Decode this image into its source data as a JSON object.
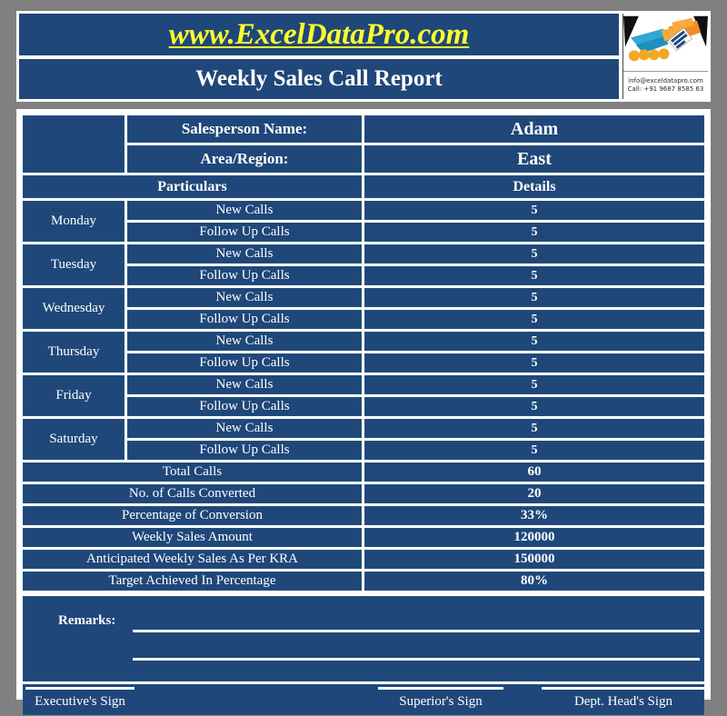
{
  "header": {
    "url": "www.ExcelDataPro.com",
    "title": "Weekly Sales Call Report",
    "logo": {
      "icon": "handshake-logo",
      "email": "info@exceldatapro.com",
      "phone": "Call: +91 9687 8585 63"
    }
  },
  "info": {
    "salesperson_label": "Salesperson Name:",
    "salesperson_value": "Adam",
    "region_label": "Area/Region:",
    "region_value": "East"
  },
  "columns": {
    "particulars": "Particulars",
    "details": "Details"
  },
  "days": [
    {
      "day": "Monday",
      "rows": [
        {
          "particular": "New Calls",
          "value": "5"
        },
        {
          "particular": "Follow Up Calls",
          "value": "5"
        }
      ]
    },
    {
      "day": "Tuesday",
      "rows": [
        {
          "particular": "New Calls",
          "value": "5"
        },
        {
          "particular": "Follow Up Calls",
          "value": "5"
        }
      ]
    },
    {
      "day": "Wednesday",
      "rows": [
        {
          "particular": "New Calls",
          "value": "5"
        },
        {
          "particular": "Follow Up Calls",
          "value": "5"
        }
      ]
    },
    {
      "day": "Thursday",
      "rows": [
        {
          "particular": "New Calls",
          "value": "5"
        },
        {
          "particular": "Follow Up Calls",
          "value": "5"
        }
      ]
    },
    {
      "day": "Friday",
      "rows": [
        {
          "particular": "New Calls",
          "value": "5"
        },
        {
          "particular": "Follow Up Calls",
          "value": "5"
        }
      ]
    },
    {
      "day": "Saturday",
      "rows": [
        {
          "particular": "New Calls",
          "value": "5"
        },
        {
          "particular": "Follow Up Calls",
          "value": "5"
        }
      ]
    }
  ],
  "summary": [
    {
      "label": "Total Calls",
      "value": "60",
      "tone": "dark"
    },
    {
      "label": "No. of Calls Converted",
      "value": "20",
      "tone": "light"
    },
    {
      "label": "Percentage of Conversion",
      "value": "33%",
      "tone": "dark"
    },
    {
      "label": "Weekly Sales Amount",
      "value": "120000",
      "tone": "light"
    },
    {
      "label": "Anticipated Weekly Sales As Per KRA",
      "value": "150000",
      "tone": "light"
    },
    {
      "label": "Target Achieved In Percentage",
      "value": "80%",
      "tone": "dark"
    }
  ],
  "remarks": {
    "label": "Remarks:",
    "value": ""
  },
  "signatures": [
    {
      "label": "Executive's Sign"
    },
    {
      "label": "Superior's Sign"
    },
    {
      "label": "Dept. Head's Sign"
    }
  ],
  "colors": {
    "background": "#808080",
    "dark_blue": "#1F4779",
    "light_blue": "#5089CE",
    "accent_yellow": "#FFFF2E",
    "paper": "#ffffff"
  }
}
